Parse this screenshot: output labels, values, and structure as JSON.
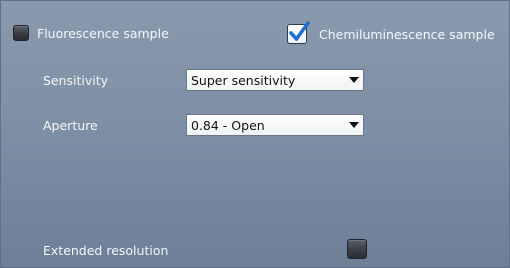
{
  "sample_type": {
    "fluorescence": {
      "label": "Fluorescence sample",
      "checked": false
    },
    "chemiluminescence": {
      "label": "Chemiluminescence sample",
      "checked": true
    }
  },
  "settings": {
    "sensitivity": {
      "label": "Sensitivity",
      "selected": "Super sensitivity"
    },
    "aperture": {
      "label": "Aperture",
      "selected": "0.84 - Open"
    }
  },
  "extended_resolution": {
    "label": "Extended resolution",
    "checked": false
  },
  "colors": {
    "background_top": "#8a9aad",
    "background_bottom": "#6d7f97",
    "checkmark": "#1f6fd1",
    "text": "#f4f6fa"
  },
  "icons": {
    "checkmark": "checkmark-icon",
    "dropdown_arrow": "chevron-down-icon"
  }
}
